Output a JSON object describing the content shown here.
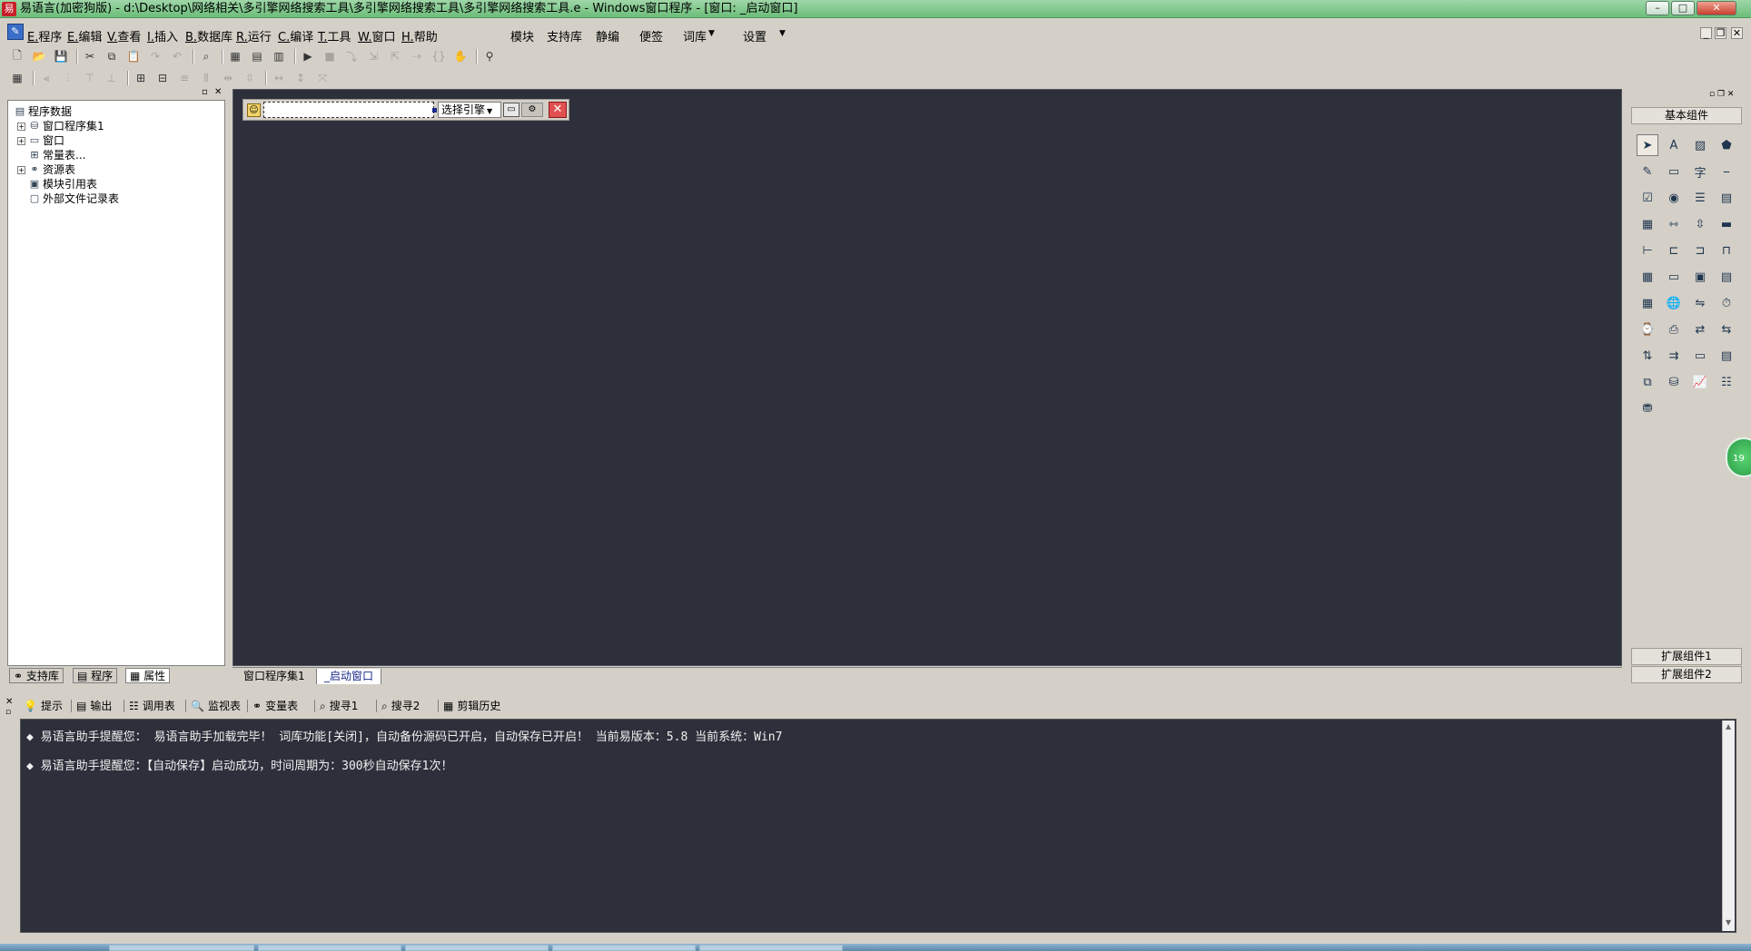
{
  "window": {
    "app_icon": "easy-language-icon",
    "title": "易语言(加密狗版) - d:\\Desktop\\网络相关\\多引擎网络搜索工具\\多引擎网络搜索工具\\多引擎网络搜索工具.e - Windows窗口程序 - [窗口: _启动窗口]",
    "controls": {
      "minimize": "–",
      "maximize": "□",
      "close": "✕"
    }
  },
  "menubar": {
    "items": [
      {
        "key": "E.",
        "label": "程序"
      },
      {
        "key": "E.",
        "label": "编辑"
      },
      {
        "key": "V.",
        "label": "查看"
      },
      {
        "key": "I.",
        "label": "插入"
      },
      {
        "key": "B.",
        "label": "数据库"
      },
      {
        "key": "R.",
        "label": "运行"
      },
      {
        "key": "C.",
        "label": "编译"
      },
      {
        "key": "T.",
        "label": "工具"
      },
      {
        "key": "W.",
        "label": "窗口"
      },
      {
        "key": "H.",
        "label": "帮助"
      }
    ],
    "extra_items": [
      "模块",
      "支持库",
      "静编",
      "便签",
      "词库",
      "设置"
    ],
    "mdi_controls": {
      "minimize": "_",
      "restore": "❐",
      "close": "✕"
    }
  },
  "left_panel": {
    "tree": [
      {
        "label": "程序数据",
        "icon": "program-data-icon",
        "level": 0,
        "expandable": false
      },
      {
        "label": "窗口程序集1",
        "icon": "assembly-icon",
        "level": 1,
        "expandable": true
      },
      {
        "label": "窗口",
        "icon": "window-icon",
        "level": 1,
        "expandable": true
      },
      {
        "label": "常量表...",
        "icon": "constants-icon",
        "level": 1,
        "expandable": false
      },
      {
        "label": "资源表",
        "icon": "resources-icon",
        "level": 1,
        "expandable": true
      },
      {
        "label": "模块引用表",
        "icon": "module-ref-icon",
        "level": 1,
        "expandable": false
      },
      {
        "label": "外部文件记录表",
        "icon": "external-file-icon",
        "level": 1,
        "expandable": false
      }
    ],
    "tabs": [
      "支持库",
      "程序",
      "属性"
    ]
  },
  "designer": {
    "engine_select": "选择引擎"
  },
  "canvas_tabs": [
    "窗口程序集1",
    "_启动窗口"
  ],
  "right_panel": {
    "header": "基本组件",
    "footer_buttons": [
      "扩展组件1",
      "扩展组件2"
    ],
    "components": [
      "pointer-icon",
      "label-icon",
      "picture-box-icon",
      "shape-icon",
      "edit-box-icon",
      "picture-frame-icon",
      "font-icon",
      "line-icon",
      "checkbox-icon",
      "radio-icon",
      "listbox-icon",
      "combo-icon",
      "table-icon",
      "hscroll-icon",
      "vscroll-icon",
      "progress-icon",
      "slider-icon",
      "tab-icon",
      "frame-icon",
      "split-icon",
      "calendar-icon",
      "button-icon",
      "folder-icon",
      "document-icon",
      "grid-icon",
      "globe-icon",
      "adjust-icon",
      "clock-icon",
      "timer-icon",
      "printer-icon",
      "network-icon",
      "server-icon",
      "client-icon",
      "port-icon",
      "dialog-icon",
      "panel-icon",
      "tree-icon",
      "database-icon",
      "chart-icon",
      "odbc-icon",
      "odbc-link-icon"
    ]
  },
  "floating_badge": "19",
  "bottom_panel": {
    "tabs": [
      {
        "label": "提示",
        "icon": "hint-icon"
      },
      {
        "label": "输出",
        "icon": "output-icon"
      },
      {
        "label": "调用表",
        "icon": "call-table-icon"
      },
      {
        "label": "监视表",
        "icon": "watch-icon"
      },
      {
        "label": "变量表",
        "icon": "variable-icon"
      },
      {
        "label": "搜寻1",
        "icon": "search1-icon"
      },
      {
        "label": "搜寻2",
        "icon": "search2-icon"
      },
      {
        "label": "剪辑历史",
        "icon": "clipboard-icon"
      }
    ],
    "output_lines": [
      "◆ 易语言助手提醒您： 易语言助手加载完毕！ 词库功能[关闭]，自动备份源码已开启，自动保存已开启！ 当前易版本：5.8  当前系统：Win7",
      "◆ 易语言助手提醒您：【自动保存】启动成功，时间周期为：300秒自动保存1次！"
    ]
  }
}
